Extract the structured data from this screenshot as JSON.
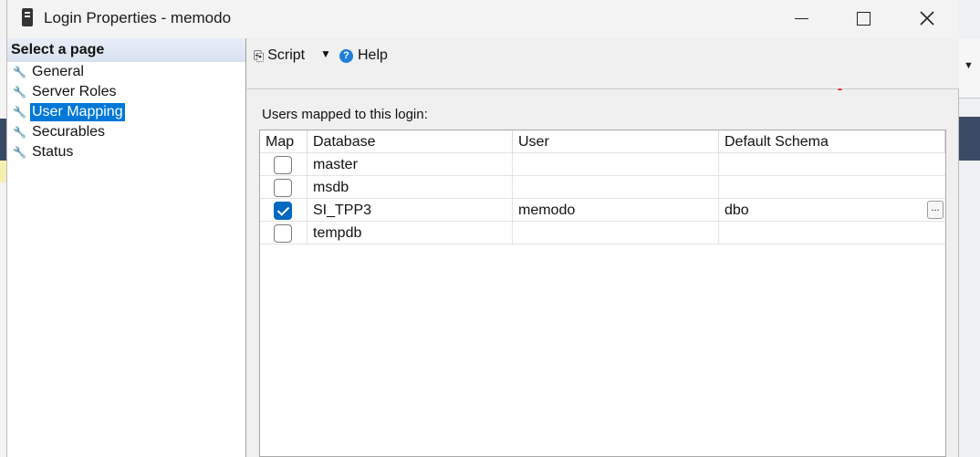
{
  "window": {
    "title": "Login Properties - memodo"
  },
  "sidebar": {
    "header": "Select a page",
    "items": [
      {
        "label": "General"
      },
      {
        "label": "Server Roles"
      },
      {
        "label": "User Mapping"
      },
      {
        "label": "Securables"
      },
      {
        "label": "Status"
      }
    ],
    "selected": "User Mapping"
  },
  "toolbar": {
    "script_label": "Script",
    "help_label": "Help"
  },
  "main": {
    "mapped_label": "Users mapped to this login:",
    "columns": [
      "Map",
      "Database",
      "User",
      "Default Schema"
    ],
    "rows": [
      {
        "map": false,
        "database": "master",
        "user": "",
        "schema": ""
      },
      {
        "map": false,
        "database": "msdb",
        "user": "",
        "schema": ""
      },
      {
        "map": true,
        "database": "SI_TPP3",
        "user": "memodo",
        "schema": "dbo",
        "ellipsis": "..."
      },
      {
        "map": false,
        "database": "tempdb",
        "user": "",
        "schema": ""
      }
    ]
  },
  "colors": {
    "accent": "#0078d7",
    "checkbox_on": "#0067c0"
  }
}
